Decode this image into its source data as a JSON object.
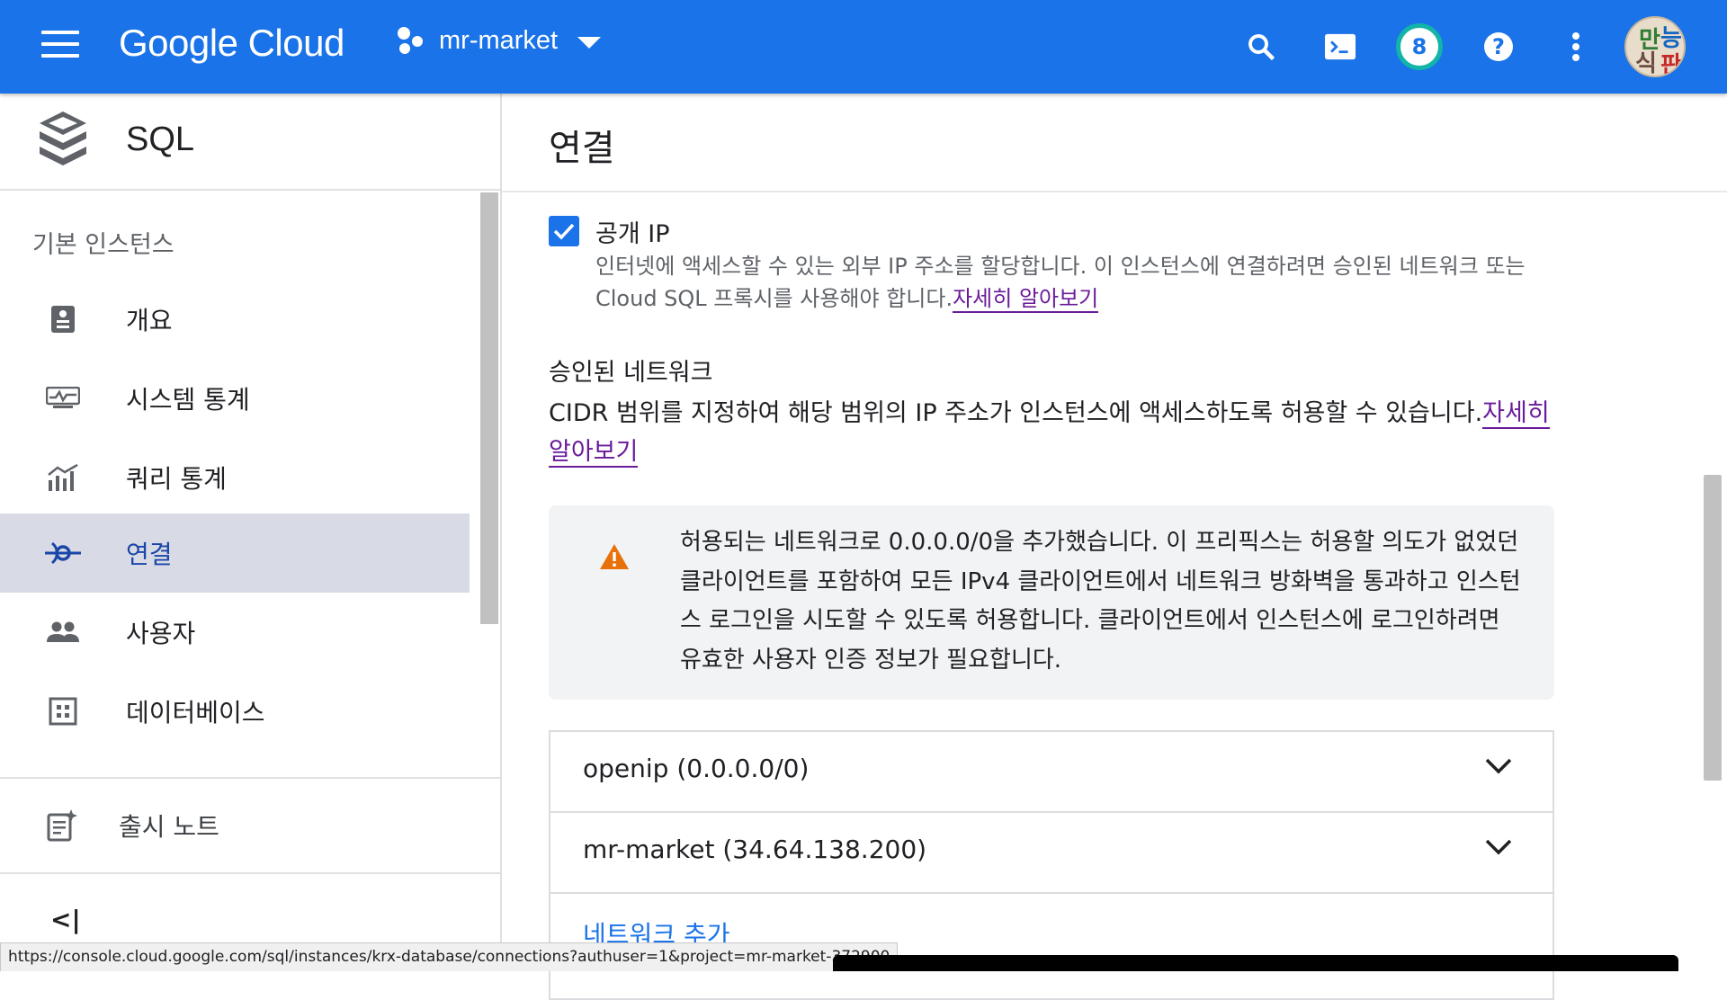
{
  "header": {
    "brand": "Google Cloud",
    "project": "mr-market",
    "notification_count": "8",
    "avatar_text": [
      "만",
      "능",
      "식",
      "판"
    ]
  },
  "sidebar": {
    "product": "SQL",
    "section": "기본 인스턴스",
    "items": [
      {
        "label": "개요",
        "icon": "dashboard-icon"
      },
      {
        "label": "시스템 통계",
        "icon": "monitoring-icon"
      },
      {
        "label": "쿼리 통계",
        "icon": "query-insights-icon"
      },
      {
        "label": "연결",
        "icon": "connections-icon",
        "active": true
      },
      {
        "label": "사용자",
        "icon": "users-icon"
      },
      {
        "label": "데이터베이스",
        "icon": "databases-icon"
      }
    ],
    "release_notes": "출시 노트",
    "collapse_label": "<|"
  },
  "main": {
    "title": "연결",
    "public_ip": {
      "label": "공개 IP",
      "checked": true,
      "description": "인터넷에 액세스할 수 있는 외부 IP 주소를 할당합니다. 이 인스턴스에 연결하려면 승인된 네트워크 또는 Cloud SQL 프록시를 사용해야 합니다.",
      "learn_more": "자세히 알아보기"
    },
    "authorized_networks": {
      "title": "승인된 네트워크",
      "description": "CIDR 범위를 지정하여 해당 범위의 IP 주소가 인스턴스에 액세스하도록 허용할 수 있습니다.",
      "learn_more": "자세히 알아보기"
    },
    "warning": "허용되는 네트워크로 0.0.0.0/0을 추가했습니다. 이 프리픽스는 허용할 의도가 없었던 클라이언트를 포함하여 모든 IPv4 클라이언트에서 네트워크 방화벽을 통과하고 인스턴스 로그인을 시도할 수 있도록 허용합니다. 클라이언트에서 인스턴스에 로그인하려면 유효한 사용자 인증 정보가 필요합니다.",
    "networks": [
      {
        "label": "openip (0.0.0.0/0)"
      },
      {
        "label": "mr-market (34.64.138.200)"
      }
    ],
    "add_network": "네트워크 추가"
  },
  "status_url": "https://console.cloud.google.com/sql/instances/krx-database/connections?authuser=1&project=mr-market-372900",
  "colors": {
    "header": "#1a73e8",
    "active_bg": "#d8dbe5",
    "warning": "#e8710a",
    "link": "#6a1b9a"
  }
}
